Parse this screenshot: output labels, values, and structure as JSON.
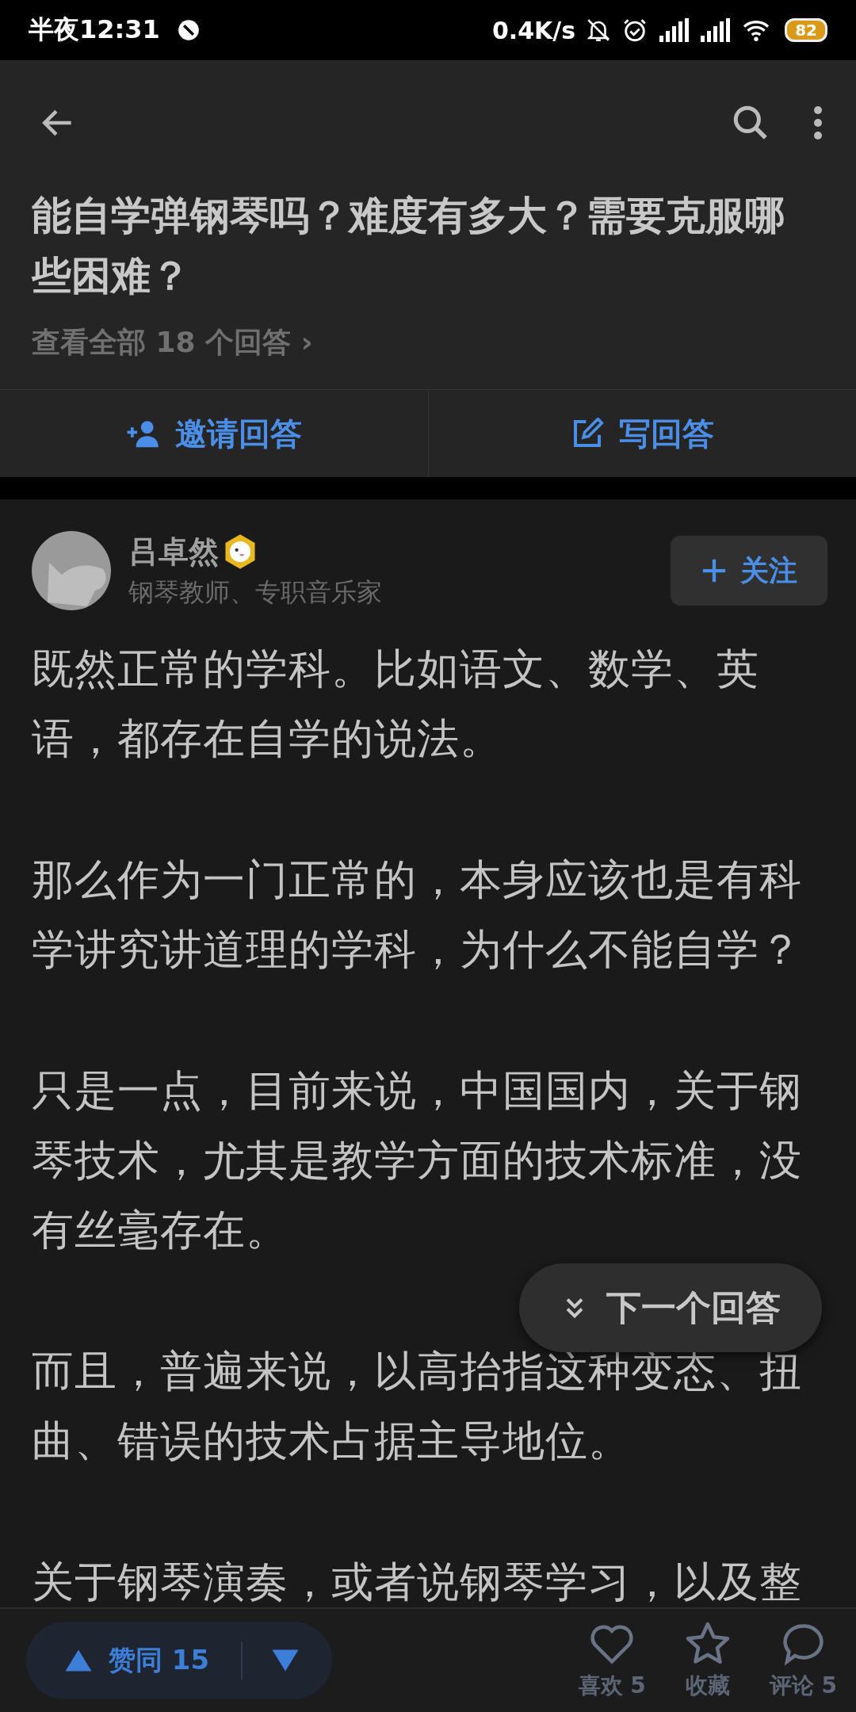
{
  "status_bar": {
    "time": "半夜12:31",
    "speed": "0.4K/s",
    "battery": "82"
  },
  "question": {
    "title": "能自学弹钢琴吗？难度有多大？需要克服哪些困难？",
    "all_answers": "查看全部 18 个回答 ›"
  },
  "actions": [
    {
      "kind": "invite",
      "label": "邀请回答"
    },
    {
      "kind": "write",
      "label": "写回答"
    }
  ],
  "author": {
    "name": "吕卓然",
    "bio": "钢琴教师、专职音乐家",
    "follow": "关注"
  },
  "paragraphs": [
    "既然正常的学科。比如语文、数学、英语，都存在自学的说法。",
    "那么作为一门正常的，本身应该也是有科学讲究讲道理的学科，为什么不能自学？",
    "只是一点，目前来说，中国国内，关于钢琴技术，尤其是教学方面的技术标准，没有丝毫存在。",
    "而且，普遍来说，以高抬指这种变态、扭曲、错误的技术占据主导地位。",
    "关于钢琴演奏，或者说钢琴学习，以及整"
  ],
  "next_answer": "下一个回答",
  "bottom_bar": {
    "vote": "赞同 15",
    "stats": [
      {
        "kind": "like",
        "label": "喜欢 5"
      },
      {
        "kind": "favorite",
        "label": "收藏"
      },
      {
        "kind": "comment",
        "label": "评论 5"
      }
    ]
  }
}
